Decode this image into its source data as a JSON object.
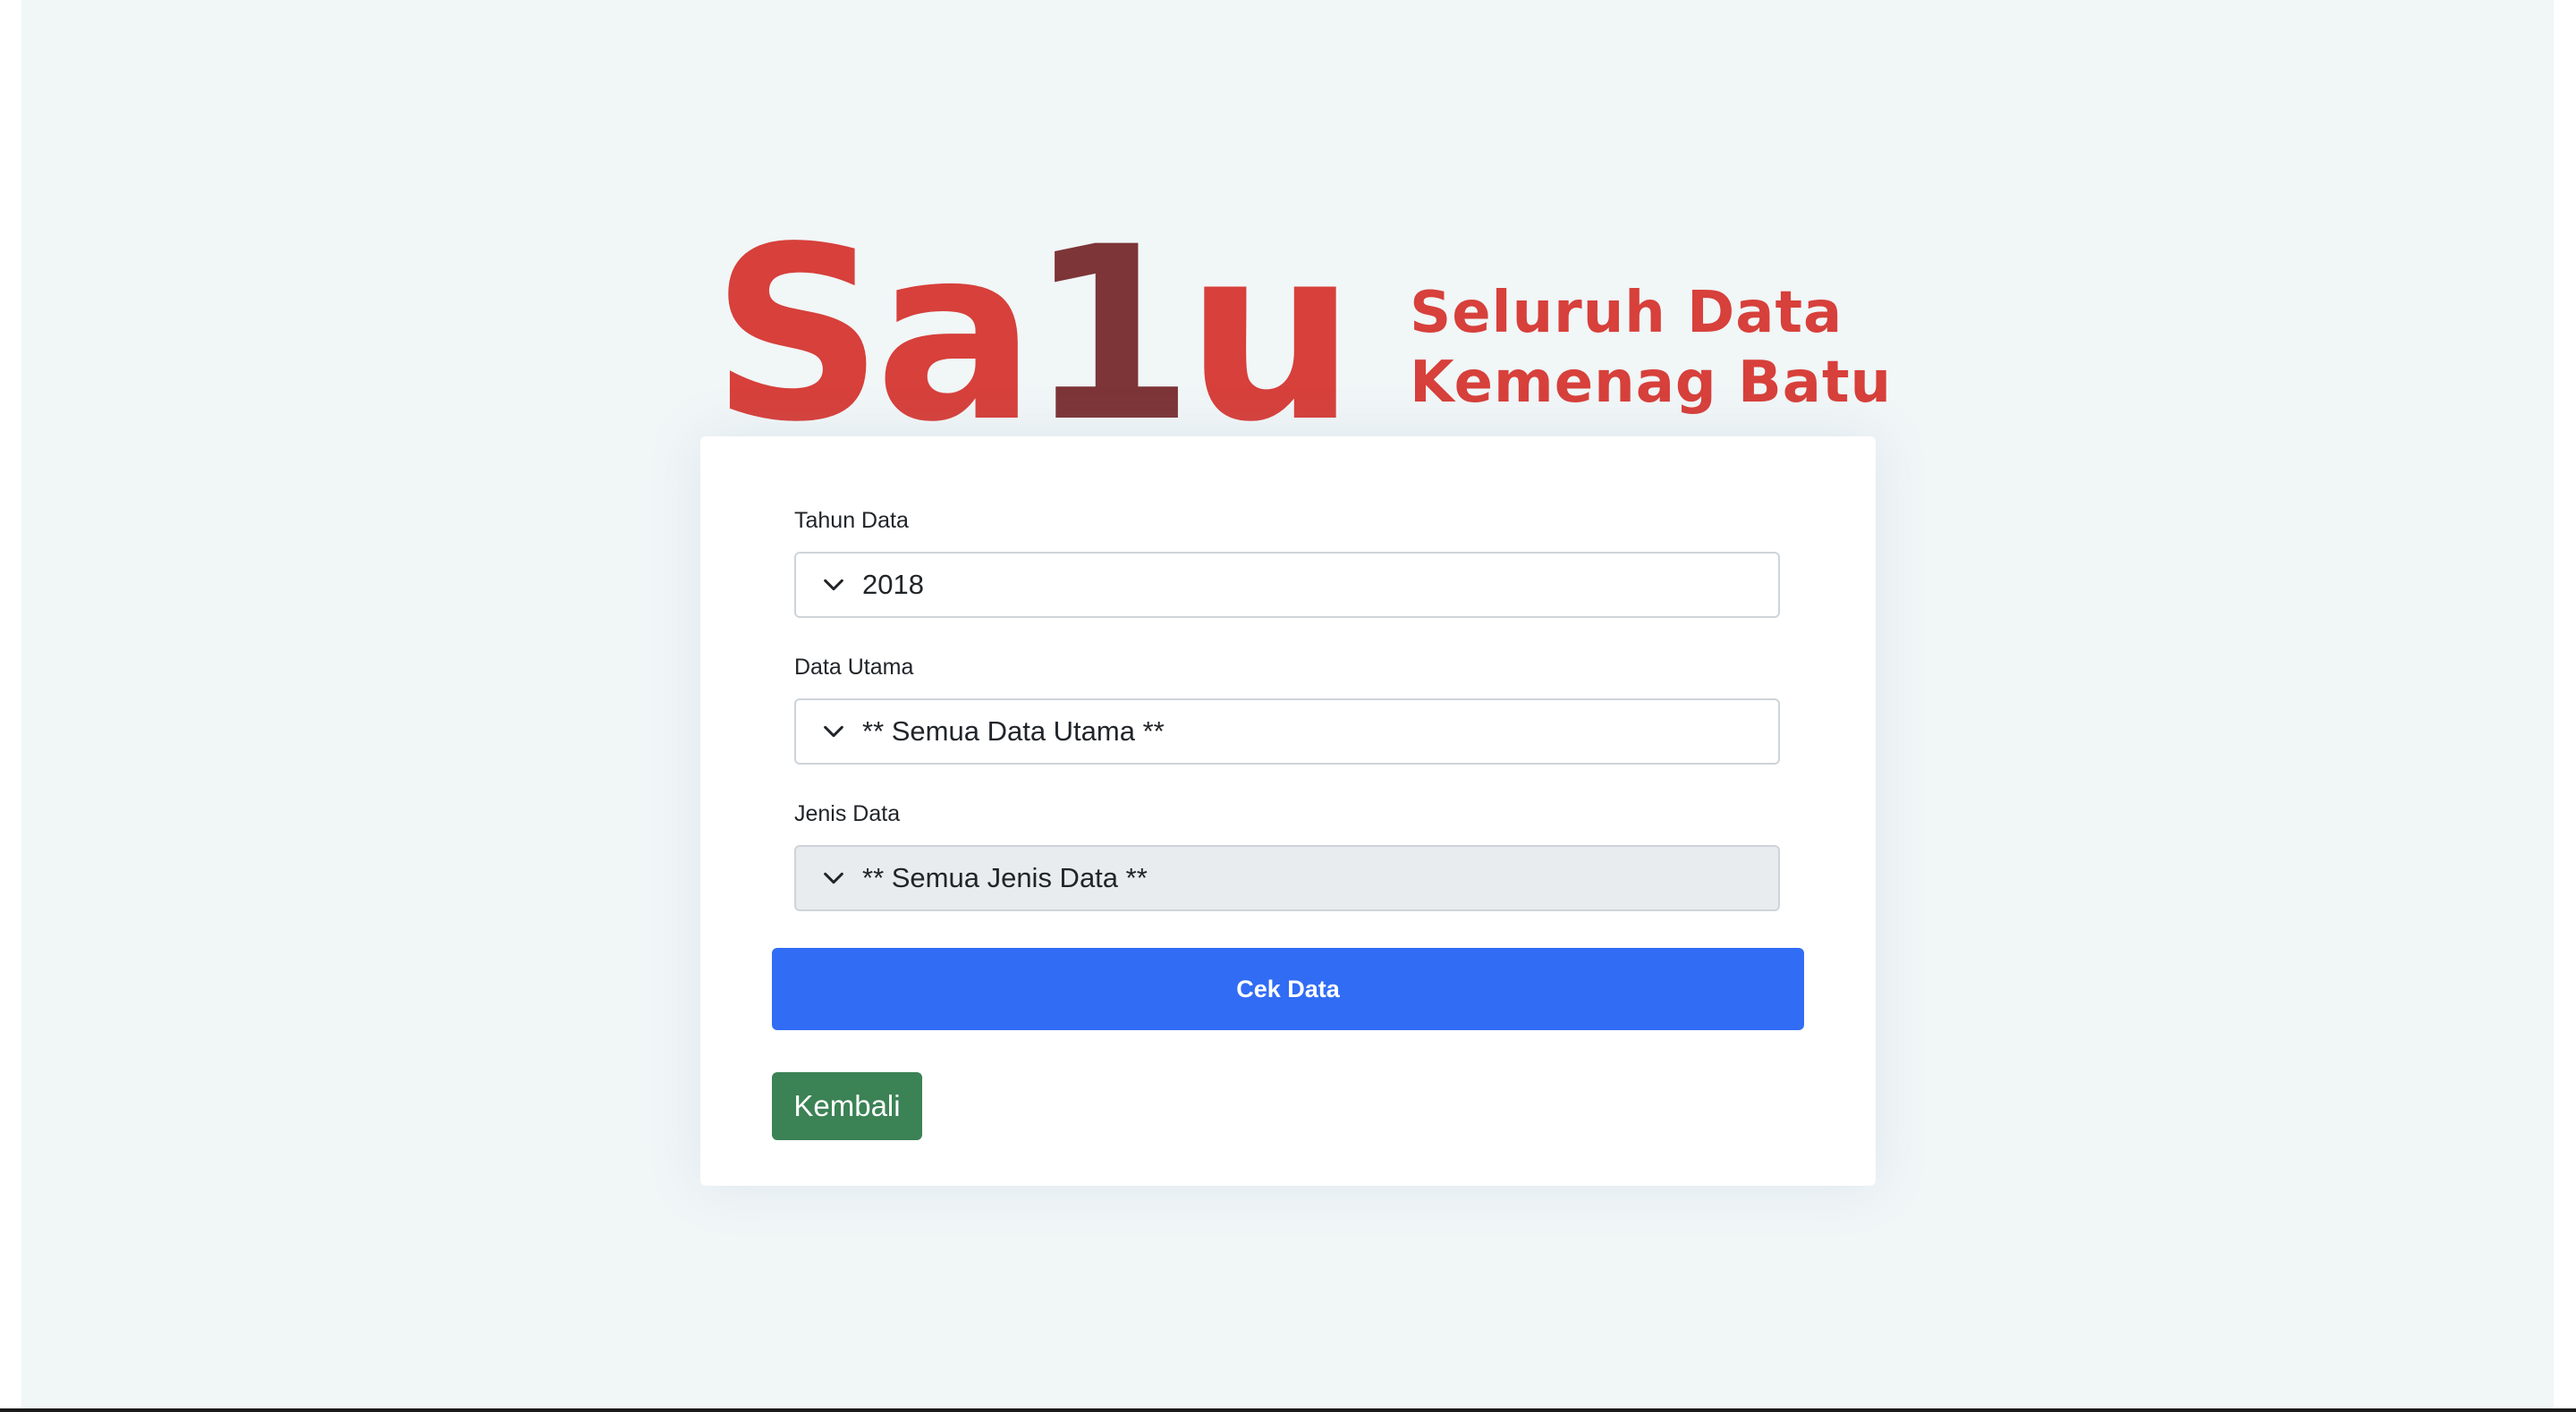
{
  "logo": {
    "main_prefix": "Sa",
    "main_digit": "1",
    "main_suffix": "u",
    "tagline_line1": "Seluruh Data",
    "tagline_line2": "Kemenag Batu",
    "brand_red": "#d7403b",
    "brand_dark": "#7d3537"
  },
  "form": {
    "tahun": {
      "label": "Tahun Data",
      "value": "2018"
    },
    "data_utama": {
      "label": "Data Utama",
      "value": "** Semua Data Utama **"
    },
    "jenis_data": {
      "label": "Jenis Data",
      "value": "** Semua Jenis Data **",
      "disabled": true
    },
    "submit_label": "Cek Data",
    "back_label": "Kembali"
  },
  "colors": {
    "primary": "#316cf4",
    "success": "#3b8255",
    "background": "#f1f6f7"
  }
}
